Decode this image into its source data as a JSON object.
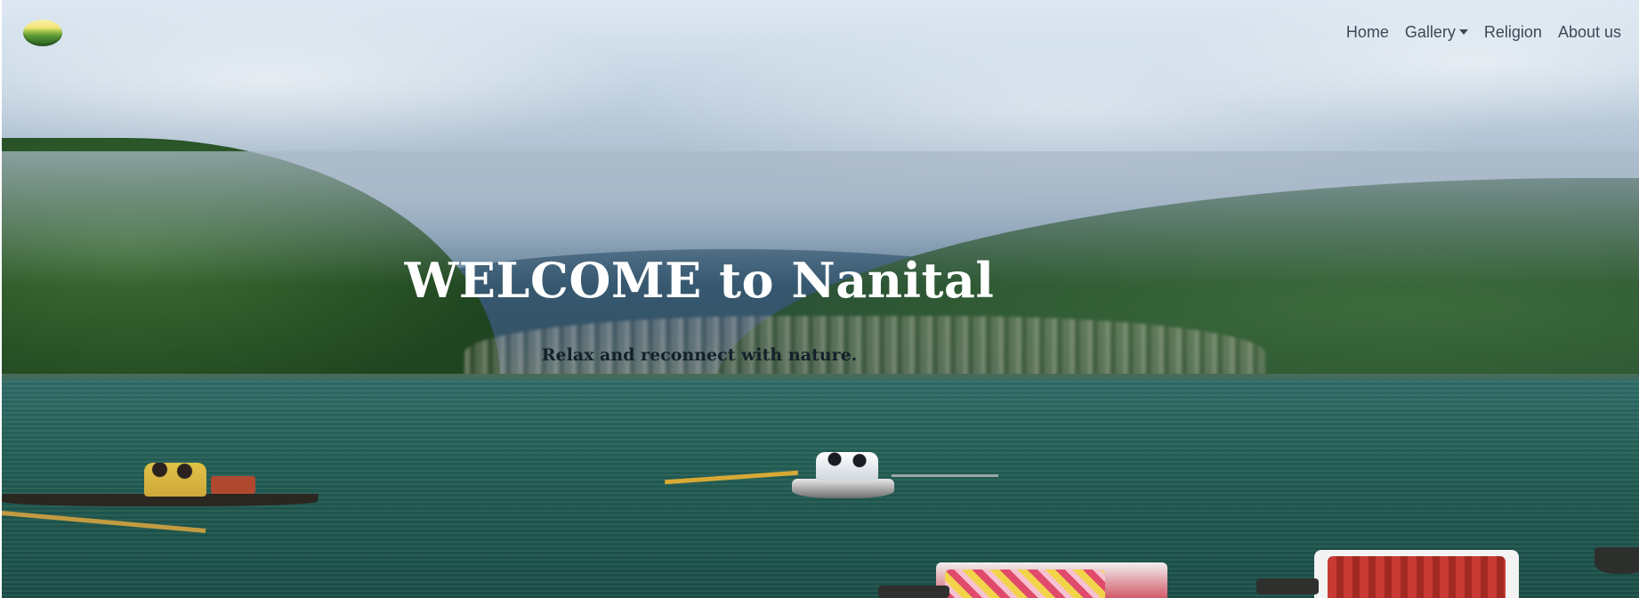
{
  "nav": {
    "brand_label": "Nanital logo",
    "items": [
      {
        "label": "Home"
      },
      {
        "label": "Gallery",
        "dropdown": true
      },
      {
        "label": "Religion"
      },
      {
        "label": "About us"
      }
    ]
  },
  "hero": {
    "title": "WELCOME to Nanital",
    "tagline": "Relax and reconnect with nature."
  },
  "colors": {
    "nav_text": "#3a4a57",
    "title_text": "#ffffff",
    "tagline_text": "#14202a"
  },
  "icons": {
    "brand": "hill-landscape-logo-icon",
    "dropdown": "caret-down-icon"
  }
}
